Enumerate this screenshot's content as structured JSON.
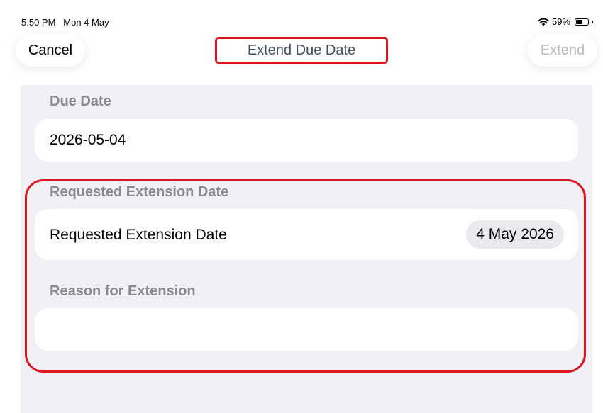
{
  "status_bar": {
    "time": "5:50 PM",
    "date": "Mon 4 May",
    "battery_text": "59%",
    "battery_level": 0.59
  },
  "nav": {
    "cancel_label": "Cancel",
    "title": "Extend Due Date",
    "extend_label": "Extend"
  },
  "due_date_section": {
    "header": "Due Date",
    "value": "2026-05-04"
  },
  "extension_section": {
    "header": "Requested Extension Date",
    "row_label": "Requested Extension Date",
    "date_value": "4 May 2026"
  },
  "reason_section": {
    "header": "Reason for Extension",
    "value": ""
  },
  "colors": {
    "highlight": "#e0141c",
    "title": "#3f5068",
    "disabled": "#b9b9be",
    "background": "#f1f0f6"
  }
}
